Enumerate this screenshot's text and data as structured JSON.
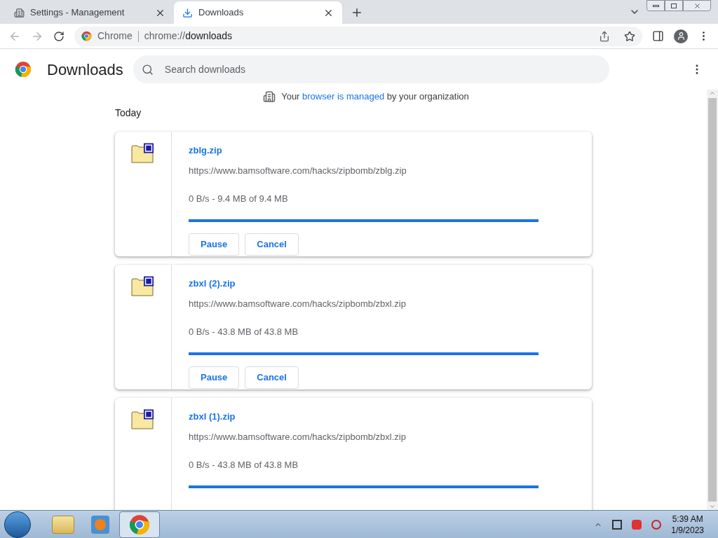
{
  "tabs": [
    {
      "title": "Settings - Management",
      "selected": false
    },
    {
      "title": "Downloads",
      "selected": true
    }
  ],
  "omnibox": {
    "chip": "Chrome",
    "url_prefix": "chrome://",
    "url_host": "downloads"
  },
  "page": {
    "title": "Downloads",
    "search_placeholder": "Search downloads"
  },
  "managed_notice": {
    "before": "Your ",
    "link": "browser is managed",
    "after": " by your organization"
  },
  "section": "Today",
  "downloads": [
    {
      "name": "zblg.zip",
      "url": "https://www.bamsoftware.com/hacks/zipbomb/zblg.zip",
      "status": "0 B/s - 9.4 MB of 9.4 MB",
      "level": 1,
      "buttons": [
        "Pause",
        "Cancel"
      ]
    },
    {
      "name": "zbxl (2).zip",
      "url": "https://www.bamsoftware.com/hacks/zipbomb/zbxl.zip",
      "status": "0 B/s - 43.8 MB of 43.8 MB",
      "level": 1,
      "buttons": [
        "Pause",
        "Cancel"
      ]
    },
    {
      "name": "zbxl (1).zip",
      "url": "https://www.bamsoftware.com/hacks/zipbomb/zbxl.zip",
      "status": "0 B/s - 43.8 MB of 43.8 MB",
      "level": 1
    }
  ],
  "taskbar": {
    "time": "5:39 AM",
    "date": "1/9/2023"
  }
}
